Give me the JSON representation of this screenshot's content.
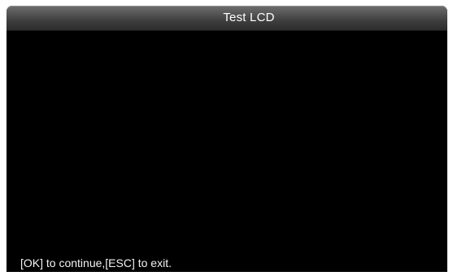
{
  "window": {
    "title": "Test LCD"
  },
  "footer": {
    "hint": "[OK] to continue,[ESC] to exit."
  },
  "colors": {
    "screen_background": "#000000",
    "title_bar_top": "#6e6e6e",
    "title_bar_bottom": "#2b2b2b",
    "text": "#ffffff"
  }
}
